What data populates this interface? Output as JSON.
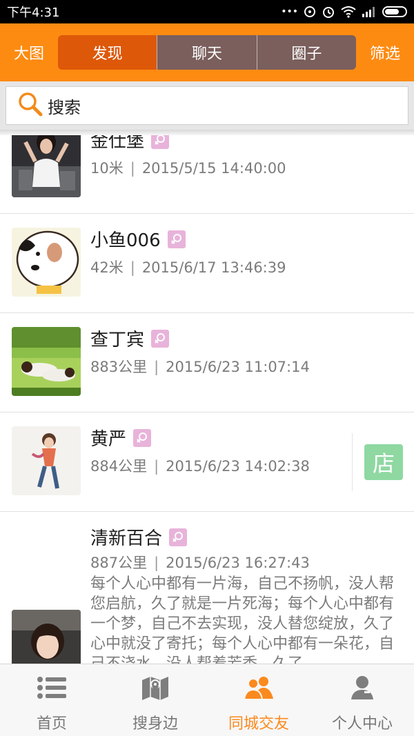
{
  "status_bar": {
    "time": "下午4:31",
    "dots": "•••"
  },
  "header": {
    "left_button": "大图",
    "right_button": "筛选",
    "tabs": [
      {
        "label": "发现",
        "active": true
      },
      {
        "label": "聊天",
        "active": false
      },
      {
        "label": "圈子",
        "active": false
      }
    ]
  },
  "search": {
    "label": "搜索"
  },
  "list": {
    "items": [
      {
        "name": "金仕堡",
        "distance": "10米",
        "separator": "|",
        "datetime": "2015/5/15 14:40:00"
      },
      {
        "name": "小鱼006",
        "distance": "42米",
        "separator": "|",
        "datetime": "2015/6/17 13:46:39"
      },
      {
        "name": "查丁宾",
        "distance": "883公里",
        "separator": "|",
        "datetime": "2015/6/23 11:07:14"
      },
      {
        "name": "黄严",
        "distance": "884公里",
        "separator": "|",
        "datetime": "2015/6/23 14:02:38",
        "badge": "店"
      },
      {
        "name": "清新百合",
        "distance": "887公里",
        "separator": "|",
        "datetime": "2015/6/23 16:27:43",
        "bio": "每个人心中都有一片海，自己不扬帆，没人帮您启航，久了就是一片死海；每个人心中都有一个梦，自己不去实现，没人替您绽放，久了心中就没了寄托；每个人心中都有一朵花，自己不浇水，没人帮着芳香，久了"
      }
    ]
  },
  "tabbar": {
    "tabs": [
      {
        "label": "首页",
        "active": false
      },
      {
        "label": "搜身边",
        "active": false
      },
      {
        "label": "同城交友",
        "active": true
      },
      {
        "label": "个人中心",
        "active": false
      }
    ]
  },
  "colors": {
    "header_orange": "#fd8b12",
    "tab_active": "#de5809",
    "tab_inactive": "#7a5f5d",
    "accent": "#fb8a1e",
    "gender_badge": "#e8b3da",
    "shop_badge": "#8fd8a2"
  }
}
